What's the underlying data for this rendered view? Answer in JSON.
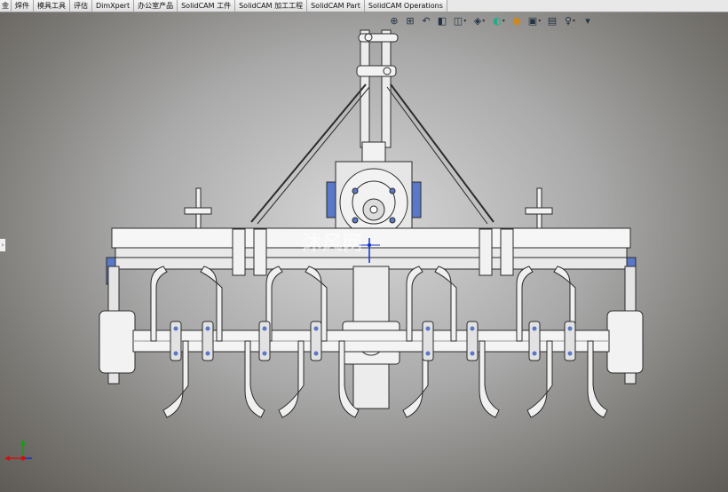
{
  "command_tabs": [
    "金",
    "焊件",
    "模具工具",
    "评估",
    "DimXpert",
    "办公室产品",
    "SolidCAM 工件",
    "SolidCAM 加工工程",
    "SolidCAM Part",
    "SolidCAM Operations"
  ],
  "heads_up_toolbar": [
    {
      "icon": "zoom-to-fit-icon",
      "glyph": "⊕",
      "dropdown": false
    },
    {
      "icon": "zoom-to-area-icon",
      "glyph": "⊞",
      "dropdown": false
    },
    {
      "icon": "previous-view-icon",
      "glyph": "↶",
      "dropdown": false
    },
    {
      "icon": "section-view-icon",
      "glyph": "◧",
      "dropdown": false
    },
    {
      "icon": "view-orientation-icon",
      "glyph": "◫",
      "dropdown": true
    },
    {
      "icon": "display-style-icon",
      "glyph": "◈",
      "dropdown": true
    },
    {
      "icon": "hide-show-items-icon",
      "glyph": "◐",
      "dropdown": true
    },
    {
      "icon": "edit-appearance-icon",
      "glyph": "●",
      "dropdown": false
    },
    {
      "icon": "apply-scene-icon",
      "glyph": "▣",
      "dropdown": true
    },
    {
      "icon": "view-settings-icon",
      "glyph": "▤",
      "dropdown": false
    },
    {
      "icon": "lights-cameras-icon",
      "glyph": "♀",
      "dropdown": true
    },
    {
      "icon": "more-icon",
      "glyph": "▾",
      "dropdown": false
    }
  ],
  "side_panel_toggle": "›",
  "watermark_text": "沐风网",
  "colors": {
    "toolbar_bg": "#e8e8e8",
    "axis_x": "#d01010",
    "axis_y": "#10a010",
    "axis_z": "#1030d0",
    "model_edge": "#2b2b2b",
    "model_fill": "#f2f2f2",
    "fastener_blue": "#5a78c8"
  }
}
